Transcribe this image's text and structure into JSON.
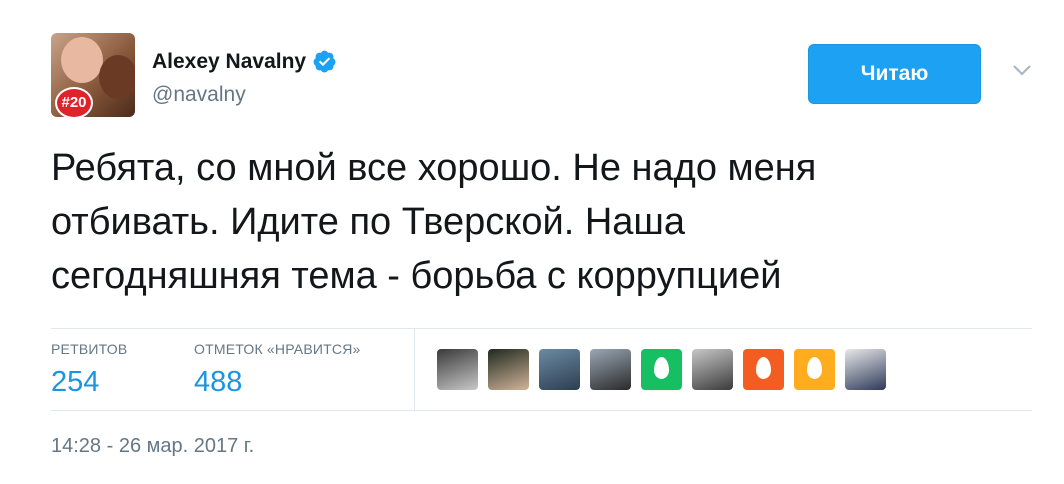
{
  "author": {
    "name": "Alexey Navalny",
    "handle": "@navalny",
    "avatar_badge": "#20",
    "verified": true
  },
  "follow_button": {
    "label": "Читаю"
  },
  "tweet": {
    "lines": [
      "Ребята, со мной все хорошо. Не надо меня",
      "отбивать. Идите по Тверской. Наша",
      "сегодняшняя тема - борьба с коррупцией"
    ]
  },
  "stats": {
    "retweets": {
      "label": "РЕТВИТОВ",
      "value": "254"
    },
    "likes": {
      "label": "ОТМЕТОК «НРАВИТСЯ»",
      "value": "488"
    }
  },
  "likers": [
    {
      "kind": "photo",
      "colors": [
        "#3a3a3a",
        "#c8c8c8"
      ]
    },
    {
      "kind": "photo",
      "colors": [
        "#1e2a1e",
        "#d2b49a"
      ]
    },
    {
      "kind": "photo",
      "colors": [
        "#6b8aa3",
        "#2c3e50"
      ]
    },
    {
      "kind": "photo",
      "colors": [
        "#9aa7b5",
        "#2a2a2a"
      ]
    },
    {
      "kind": "egg",
      "colors": [
        "#17bf63",
        "#17bf63"
      ]
    },
    {
      "kind": "photo",
      "colors": [
        "#c7c7c7",
        "#3b3b3b"
      ]
    },
    {
      "kind": "egg",
      "colors": [
        "#f45d22",
        "#f45d22"
      ]
    },
    {
      "kind": "egg",
      "colors": [
        "#ffad1f",
        "#ffad1f"
      ]
    },
    {
      "kind": "photo",
      "colors": [
        "#e8e8e8",
        "#2d3a5a"
      ]
    }
  ],
  "timestamp": "14:28 - 26 мар. 2017 г.",
  "colors": {
    "accent": "#1da1f2",
    "link": "#1b95e0",
    "muted": "#657786"
  }
}
